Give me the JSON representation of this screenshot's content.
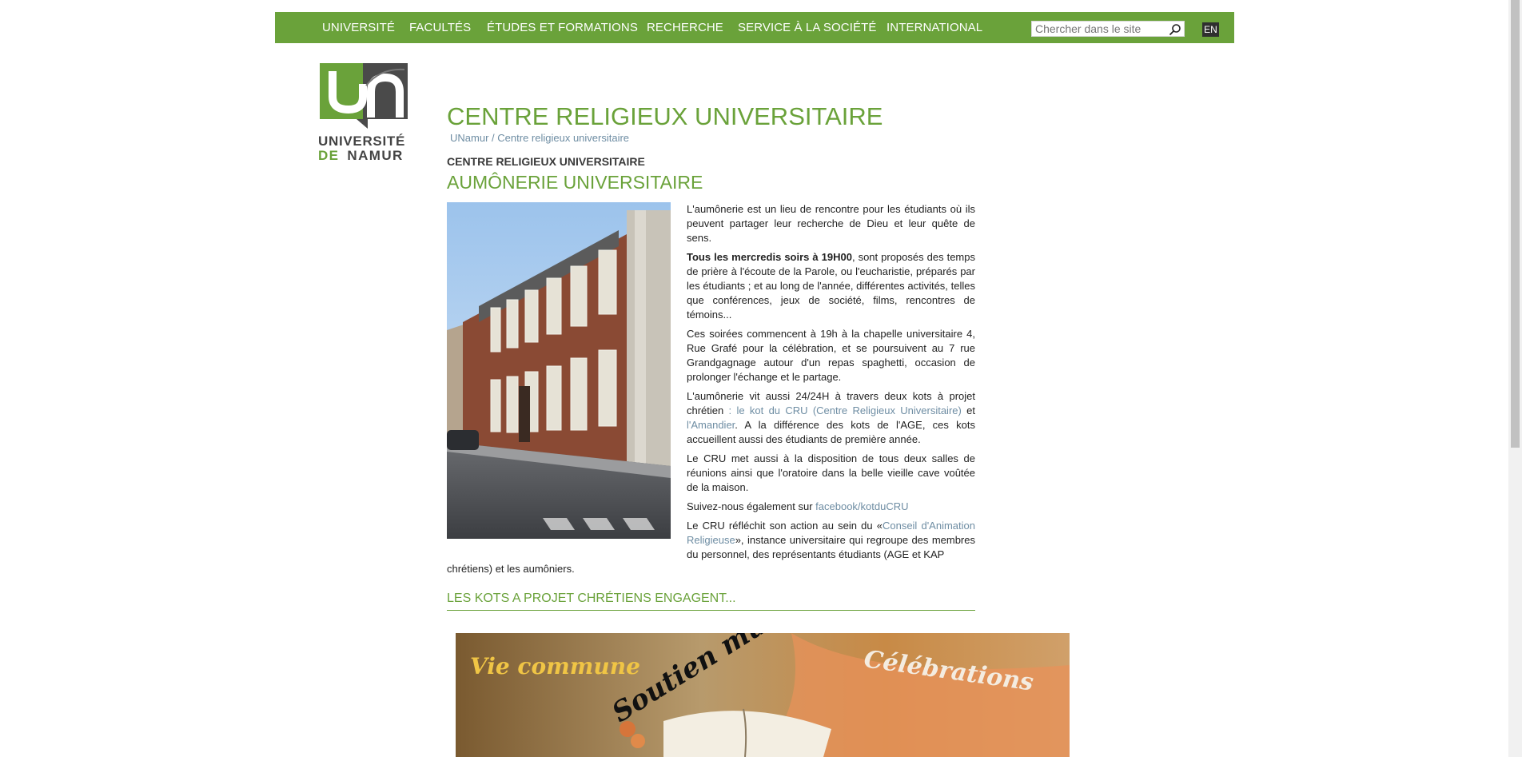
{
  "nav": {
    "items": [
      {
        "label": "UNIVERSITÉ"
      },
      {
        "label": "FACULTÉS"
      },
      {
        "label": "ÉTUDES ET FORMATIONS"
      },
      {
        "label": "RECHERCHE"
      },
      {
        "label": "SERVICE À LA SOCIÉTÉ"
      },
      {
        "label": "INTERNATIONAL"
      }
    ],
    "search_placeholder": "Chercher dans le site",
    "lang": "EN"
  },
  "logo": {
    "line1": "UNIVERSITÉ",
    "line2_de": "DE",
    "line2_namur": "NAMUR"
  },
  "page": {
    "title": "CENTRE RELIGIEUX UNIVERSITAIRE",
    "breadcrumb": {
      "home": "UNamur",
      "sep": "/",
      "current": "Centre religieux universitaire"
    },
    "section_label": "CENTRE RELIGIEUX UNIVERSITAIRE",
    "section_title": "AUMÔNERIE UNIVERSITAIRE"
  },
  "content": {
    "p1": "L'aumônerie est un lieu de rencontre pour les étudiants où ils peuvent partager leur recherche de Dieu et leur quête de sens.",
    "p2_bold": "Tous les mercredis soirs à 19H00",
    "p2_rest": ", sont proposés des temps de prière à l'écoute de la Parole, ou l'eucharistie, préparés par les étudiants ; et au long de l'année, différentes activités, telles que conférences, jeux de société, films, rencontres de témoins...",
    "p3": "Ces soirées commencent à 19h à la chapelle universitaire 4, Rue Grafé pour la célébration, et se poursuivent au 7 rue Grandgagnage autour d'un repas spaghetti, occasion de prolonger l'échange et le partage.",
    "p4_a": "L'aumônerie vit aussi 24/24H à travers deux kots à projet chrétien",
    "p4_link1": " : le kot du CRU (Centre Religieux Universitaire)",
    "p4_b": " et ",
    "p4_link2": "l'Amandier",
    "p4_c": ". A la différence des kots de l'AGE, ces kots accueillent aussi des étudiants de première année.",
    "p5": "Le CRU met aussi à la disposition de tous deux salles de réunions ainsi que l'oratoire dans la belle vieille cave voûtée de la maison.",
    "p6_a": "Suivez-nous également sur ",
    "p6_link": "facebook/kotduCRU",
    "p7_a": "Le CRU réfléchit son action au sein du «",
    "p7_link": "Conseil d'Animation Religieuse",
    "p7_b": "», instance universitaire qui regroupe des membres du personnel, des représentants étudiants (AGE et KAP",
    "tail": "chrétiens) et les aumôniers."
  },
  "kots": {
    "title": "LES KOTS A PROJET CHRÉTIENS ENGAGENT...",
    "banner_words": [
      "Vie commune",
      "Soutien mutuel",
      "Célébrations"
    ]
  }
}
